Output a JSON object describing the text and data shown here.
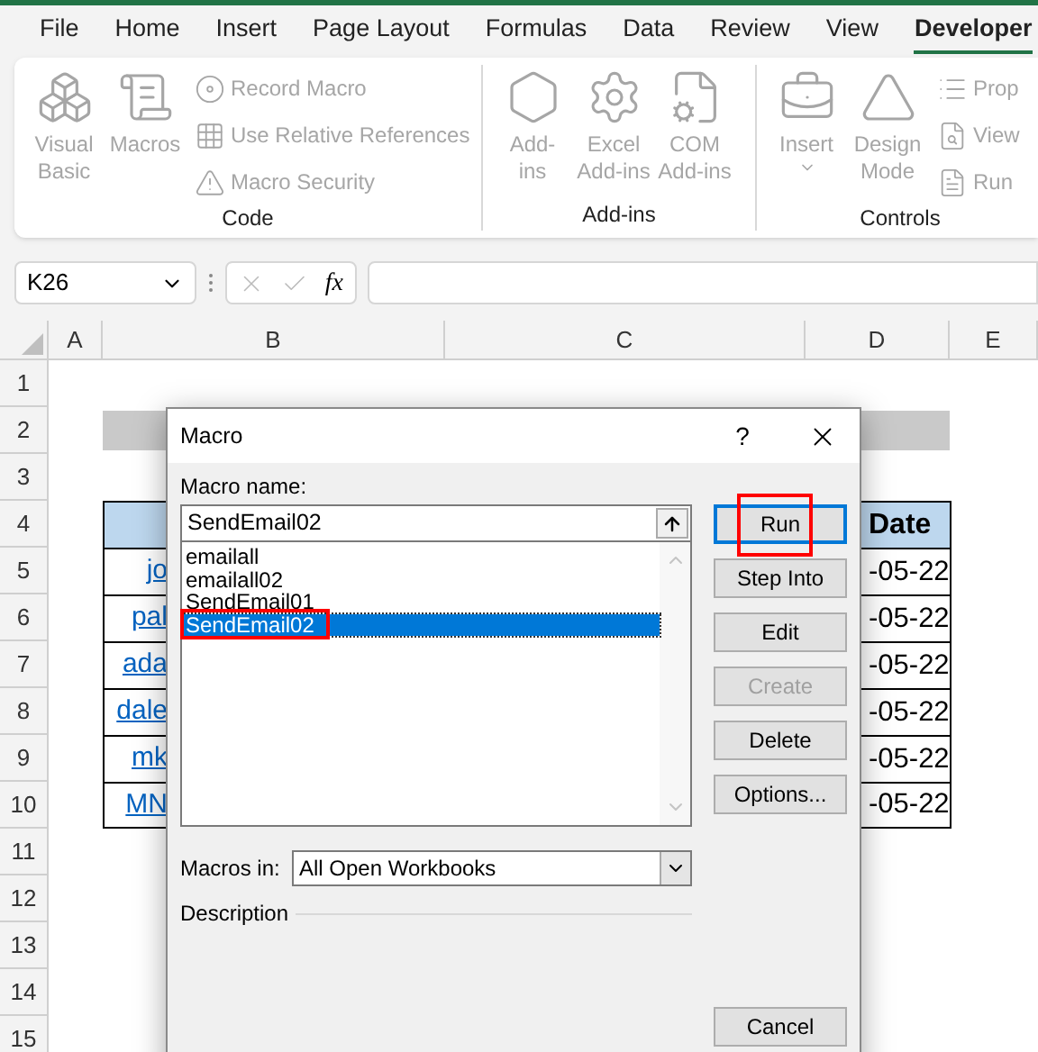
{
  "ribbon": {
    "tabs": [
      {
        "label": "File",
        "selected": false
      },
      {
        "label": "Home",
        "selected": false
      },
      {
        "label": "Insert",
        "selected": false
      },
      {
        "label": "Page Layout",
        "selected": false
      },
      {
        "label": "Formulas",
        "selected": false
      },
      {
        "label": "Data",
        "selected": false
      },
      {
        "label": "Review",
        "selected": false
      },
      {
        "label": "View",
        "selected": false
      },
      {
        "label": "Developer",
        "selected": true
      }
    ],
    "groups": [
      {
        "label": "Code",
        "large": [
          {
            "lines": [
              "Visual",
              "Basic"
            ],
            "disabled": true
          },
          {
            "lines": [
              "Macros"
            ],
            "disabled": true
          }
        ],
        "small": [
          {
            "label": "Record Macro",
            "disabled": true
          },
          {
            "label": "Use Relative References",
            "disabled": true
          },
          {
            "label": "Macro Security",
            "disabled": true
          }
        ]
      },
      {
        "label": "Add-ins",
        "large": [
          {
            "lines": [
              "Add-",
              "ins"
            ],
            "disabled": true
          },
          {
            "lines": [
              "Excel",
              "Add-ins"
            ],
            "disabled": true
          },
          {
            "lines": [
              "COM",
              "Add-ins"
            ],
            "disabled": true
          }
        ]
      },
      {
        "label": "Controls",
        "large": [
          {
            "lines": [
              "Insert"
            ],
            "disabled": true,
            "dropdown": true
          },
          {
            "lines": [
              "Design",
              "Mode"
            ],
            "disabled": true
          }
        ],
        "small": [
          {
            "label": "Prop",
            "disabled": true
          },
          {
            "label": "View",
            "disabled": true
          },
          {
            "label": "Run",
            "disabled": true
          }
        ]
      }
    ]
  },
  "formula_bar": {
    "name_box": "K26",
    "fx": "fx"
  },
  "sheet": {
    "columns": [
      "A",
      "B",
      "C",
      "D",
      "E"
    ],
    "rows": [
      {
        "number": "1",
        "kind": "empty"
      },
      {
        "number": "2",
        "kind": "title"
      },
      {
        "number": "3",
        "kind": "empty"
      },
      {
        "number": "4",
        "kind": "header",
        "d": "Date"
      },
      {
        "number": "5",
        "kind": "data",
        "b": "jo",
        "d": "-05-22"
      },
      {
        "number": "6",
        "kind": "data",
        "b": "pal",
        "d": "-05-22"
      },
      {
        "number": "7",
        "kind": "data",
        "b": "ada",
        "d": "-05-22"
      },
      {
        "number": "8",
        "kind": "data",
        "b": "dale",
        "d": "-05-22"
      },
      {
        "number": "9",
        "kind": "data",
        "b": "mk",
        "d": "-05-22"
      },
      {
        "number": "10",
        "kind": "data",
        "b": "MN",
        "d": "-05-22"
      },
      {
        "number": "11",
        "kind": "empty"
      },
      {
        "number": "12",
        "kind": "empty"
      },
      {
        "number": "13",
        "kind": "empty"
      },
      {
        "number": "14",
        "kind": "empty"
      },
      {
        "number": "15",
        "kind": "empty"
      }
    ]
  },
  "dialog": {
    "title": "Macro",
    "help": "?",
    "name_label": "Macro name:",
    "name_value": "SendEmail02",
    "macros": [
      {
        "name": "emailall",
        "selected": false,
        "annotated": false
      },
      {
        "name": "emailall02",
        "selected": false,
        "annotated": false
      },
      {
        "name": "SendEmail01",
        "selected": false,
        "annotated": false
      },
      {
        "name": "SendEmail02",
        "selected": true,
        "annotated": true
      }
    ],
    "buttons": [
      {
        "label": "Run",
        "default": true,
        "disabled": false,
        "annotated": true
      },
      {
        "label": "Step Into",
        "default": false,
        "disabled": false,
        "annotated": false
      },
      {
        "label": "Edit",
        "default": false,
        "disabled": false,
        "annotated": false
      },
      {
        "label": "Create",
        "default": false,
        "disabled": true,
        "annotated": false
      },
      {
        "label": "Delete",
        "default": false,
        "disabled": false,
        "annotated": false
      },
      {
        "label": "Options...",
        "default": false,
        "disabled": false,
        "annotated": false
      }
    ],
    "macros_in_label": "Macros in:",
    "macros_in_value": "All Open Workbooks",
    "description_label": "Description",
    "cancel": "Cancel"
  }
}
